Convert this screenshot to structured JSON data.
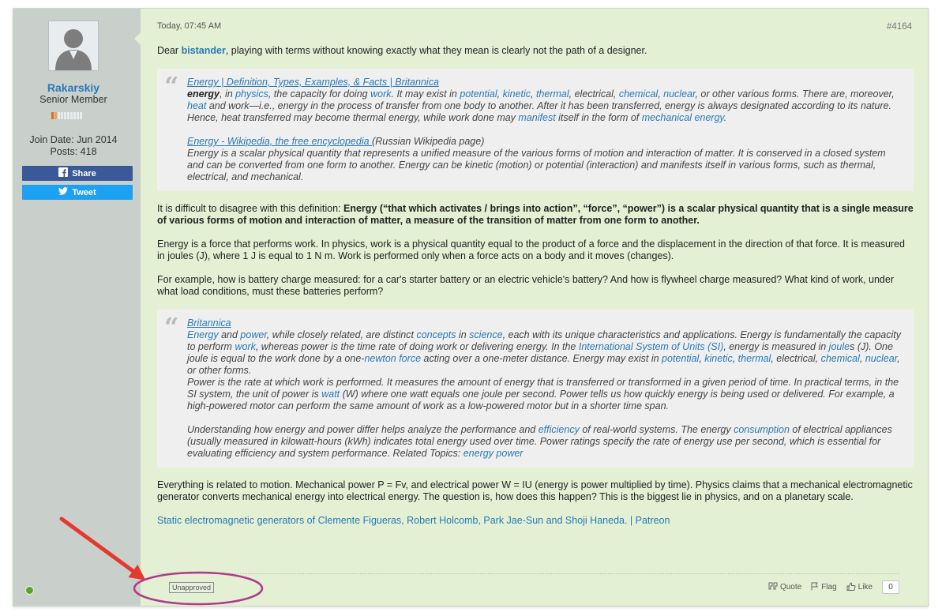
{
  "sidebar": {
    "username": "Rakarskiy",
    "user_title": "Senior Member",
    "join_date": "Join Date: Jun 2014",
    "posts": "Posts: 418",
    "share_label": "Share",
    "tweet_label": "Tweet",
    "reputation": {
      "filled": 2,
      "total": 10
    }
  },
  "post": {
    "date": "Today, 07:45 AM",
    "number": "#4164",
    "greeting_prefix": "Dear ",
    "greeting_user": "bistander",
    "greeting_rest": ", playing with terms without knowing exactly what they mean is clearly not the path of a designer.",
    "quote1": {
      "src1": "Energy | Definition, Types, Examples, & Facts | Britannica",
      "s1_bold": "energy",
      "s1_t1": ", in ",
      "s1_l1": "physics",
      "s1_t2": ", the capacity for doing ",
      "s1_l2": "work",
      "s1_t3": ". It may exist in ",
      "s1_l3": "potential",
      "s1_t4": ", ",
      "s1_l4": "kinetic",
      "s1_t5": ", ",
      "s1_l5": "thermal",
      "s1_t6": ", electrical, ",
      "s1_l6": "chemical",
      "s1_t7": ", ",
      "s1_l7": "nuclear",
      "s1_t8": ", or other various forms. There are, moreover, ",
      "s1_l8": "heat",
      "s1_t9": " and work—i.e., energy in the process of transfer from one body to another. After it has been transferred, energy is always designated according to its nature. Hence, heat transferred may become thermal energy, while work done may ",
      "s1_l9": "manifest",
      "s1_t10": " itself in the form of ",
      "s1_l10": "mechanical energy",
      "s1_t11": ".",
      "src2": "Energy - Wikipedia, the free encyclopedia ",
      "src2_suffix": "(Russian Wikipedia page)",
      "s2_text": "Energy is a scalar physical quantity that represents a unified measure of the various forms of motion and interaction of matter. It is conserved in a closed system and can be converted from one form to another. Energy can be kinetic (motion) or potential (interaction) and manifests itself in various forms, such as thermal, electrical, and mechanical."
    },
    "para1_plain": "It is difficult to disagree with this definition: ",
    "para1_bold": "Energy (“that which activates / brings into action”, “force”, “power”) is a scalar physical quantity that is a single measure of various forms of motion and interaction of matter, a measure of the transition of matter from one form to another.",
    "para2": "Energy is a force that performs work. In physics, work is a physical quantity equal to the product of a force and the displacement in the direction of that force. It is measured in joules (J), where 1 J is equal to 1 N m. Work is performed only when a force acts on a body and it moves (changes).",
    "para3": "For example, how is battery charge measured: for a car's starter battery or an electric vehicle's battery? And how is flywheel charge measured? What kind of work, under what load conditions, must these batteries perform?",
    "quote2": {
      "src": "Britannica",
      "l1": "Energy",
      "t1": " and ",
      "l2": "power",
      "t2": ", while closely related, are distinct ",
      "l3": "concepts",
      "t3": " in ",
      "l4": "science",
      "t4": ", each with its unique characteristics and applications. Energy is fundamentally the capacity to perform ",
      "l5": "work",
      "t5": ", whereas power is the time rate of doing work or delivering energy. In the ",
      "l6": "International System of Units (SI)",
      "t6": ", energy is measured in ",
      "l7": "joule",
      "t7": "s (J). One joule is equal to the work done by a one-",
      "l8": "newton force",
      "t8": " acting over a one-meter distance. Energy may exist in ",
      "l9": "potential",
      "t9": ", ",
      "l10": "kinetic",
      "t10": ", ",
      "l11": "thermal",
      "t11": ", electrical, ",
      "l12": "chemical",
      "t12": ", ",
      "l13": "nuclear",
      "t13": ", or other forms.",
      "p2_t1": "Power is the rate at which work is performed. It measures the amount of energy that is transferred or transformed in a given period of time. In practical terms, in the SI system, the unit of power is ",
      "p2_l1": "watt",
      "p2_t2": " (W) where one watt equals one joule per second. Power tells us how quickly energy is being used or delivered. For example, a high-powered motor can perform the same amount of work as a low-powered motor but in a shorter time span.",
      "p3_t1": "Understanding how energy and power differ helps analyze the performance and ",
      "p3_l1": "efficiency",
      "p3_t2": " of real-world systems. The energy ",
      "p3_l2": "consumption",
      "p3_t3": " of electrical appliances (usually measured in kilowatt-hours (kWh) indicates total energy used over time. Power ratings specify the rate of energy use per second, which is essential for evaluating efficiency and system performance. Related Topics: ",
      "p3_l3": "energy power"
    },
    "para4": "Everything is related to motion. Mechanical power P = Fv, and electrical power W = IU (energy is power multiplied by time). Physics claims that a mechanical electromagnetic generator converts mechanical energy into electrical energy. The question is, how does this happen? This is the biggest lie in physics, and on a planetary scale.",
    "signature_link": "Static electromagnetic generators of Clemente Figueras, Robert Holcomb, Park Jae-Sun and Shoji Haneda. | Patreon",
    "status_badge": "Unapproved",
    "quote_label": "Quote",
    "flag_label": "Flag",
    "like_label": "Like",
    "like_count": "0"
  },
  "colors": {
    "sidebar_bg": "#c9d0cb",
    "content_bg": "#e3f0d3",
    "link": "#2a79b8",
    "annotation": "#e23a2e",
    "annotation_ellipse": "#b03a8c"
  },
  "icons": [
    "user-avatar-icon",
    "facebook-icon",
    "twitter-icon",
    "quote-icon",
    "flag-icon",
    "like-icon",
    "online-status-icon",
    "blockquote-mark-icon"
  ]
}
